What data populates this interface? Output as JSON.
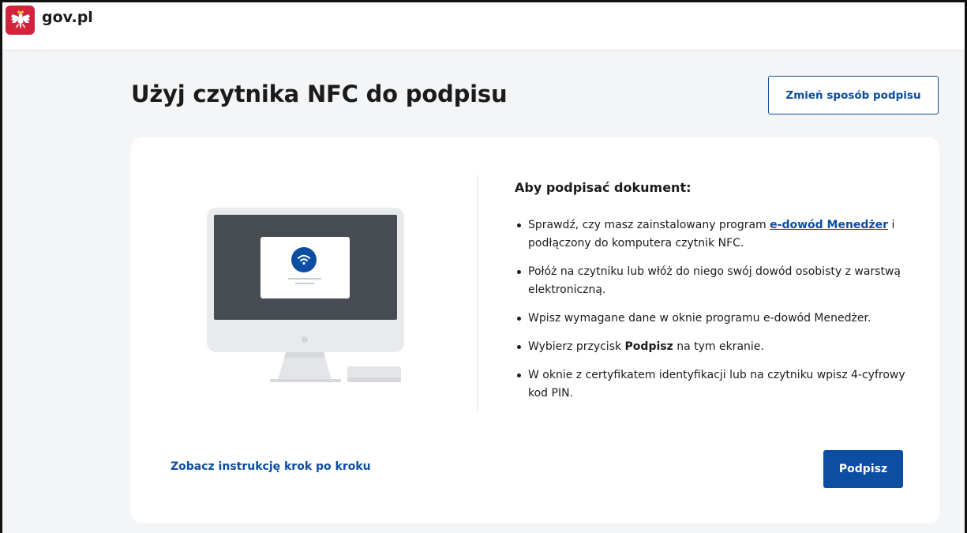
{
  "header": {
    "brand": "gov.pl",
    "emblem_icon": "polish-eagle-icon",
    "emblem_color": "#d4213d"
  },
  "page": {
    "title": "Użyj czytnika NFC do podpisu",
    "change_method_label": "Zmień sposób podpisu"
  },
  "instructions": {
    "title": "Aby podpisać dokument:",
    "step1_before": "Sprawdź, czy masz zainstalowany program ",
    "step1_link": "e-dowód Menedżer",
    "step1_after": " i podłączony do komputera czytnik NFC.",
    "step2": "Połóż na czytniku lub włóż do niego swój dowód osobisty z warstwą elektroniczną.",
    "step3": "Wpisz wymagane dane w oknie programu e-dowód Menedżer.",
    "step4_before": "Wybierz przycisk ",
    "step4_bold": "Podpisz",
    "step4_after": " na tym ekranie.",
    "step5": "W oknie z certyfikatem identyfikacji lub na czytniku wpisz 4-cyfrowy kod PIN."
  },
  "illustration": {
    "icon": "nfc-computer-illustration",
    "wireless_icon": "wireless-icon"
  },
  "footer": {
    "instruction_link": "Zobacz instrukcję krok po kroku",
    "sign_button": "Podpisz"
  },
  "colors": {
    "accent": "#0b4ea2",
    "background": "#f4f5f7",
    "card": "#ffffff",
    "text": "#1b1b1b"
  }
}
